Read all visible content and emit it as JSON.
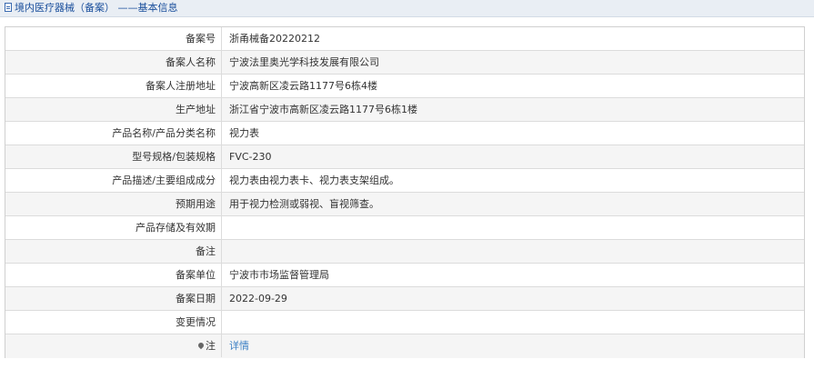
{
  "header": {
    "title": "境内医疗器械（备案） ——基本信息"
  },
  "rows": [
    {
      "label": "备案号",
      "value": "浙甬械备20220212"
    },
    {
      "label": "备案人名称",
      "value": "宁波法里奥光学科技发展有限公司"
    },
    {
      "label": "备案人注册地址",
      "value": "宁波高新区凌云路1177号6栋4楼"
    },
    {
      "label": "生产地址",
      "value": "浙江省宁波市高新区凌云路1177号6栋1楼"
    },
    {
      "label": "产品名称/产品分类名称",
      "value": "视力表"
    },
    {
      "label": "型号规格/包装规格",
      "value": "FVC-230"
    },
    {
      "label": "产品描述/主要组成成分",
      "value": "视力表由视力表卡、视力表支架组成。"
    },
    {
      "label": "预期用途",
      "value": "用于视力检测或弱视、盲视筛查。"
    },
    {
      "label": "产品存储及有效期",
      "value": ""
    },
    {
      "label": "备注",
      "value": ""
    },
    {
      "label": "备案单位",
      "value": "宁波市市场监督管理局"
    },
    {
      "label": "备案日期",
      "value": "2022-09-29"
    },
    {
      "label": "变更情况",
      "value": ""
    },
    {
      "label": "注",
      "value": "详情",
      "icon": "pin-icon"
    }
  ],
  "colors": {
    "title": "#1a4f9c",
    "link": "#3b7fc4",
    "header_bg": "#e9eef4",
    "row_alt_bg": "#f5f5f5",
    "border": "#dcdcdc"
  }
}
